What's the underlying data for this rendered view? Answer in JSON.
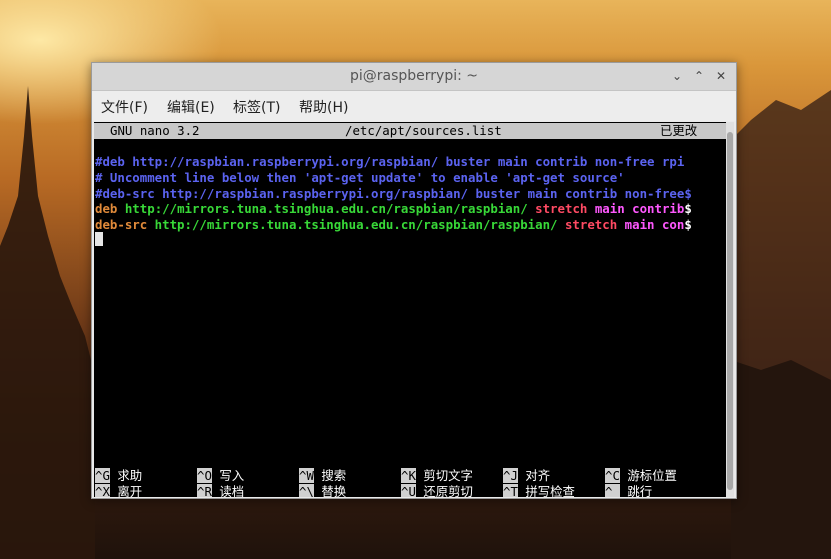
{
  "window": {
    "title": "pi@raspberrypi: ~",
    "controls": [
      "⌄",
      "⌃",
      "✕"
    ]
  },
  "menubar": {
    "items": [
      "文件(F)",
      "编辑(E)",
      "标签(T)",
      "帮助(H)"
    ]
  },
  "nano": {
    "version": "GNU nano 3.2",
    "filename": "/etc/apt/sources.list",
    "status": "已更改"
  },
  "lines": [
    {
      "segments": [
        {
          "text": "#deb http://raspbian.raspberrypi.org/raspbian/ buster main contrib non-free rpi",
          "color": "blue"
        }
      ]
    },
    {
      "segments": [
        {
          "text": "# Uncomment line below then 'apt-get update' to enable 'apt-get source'",
          "color": "blue"
        }
      ]
    },
    {
      "segments": [
        {
          "text": "#deb-src http://raspbian.raspberrypi.org/raspbian/ buster main contrib non-free$",
          "color": "blue"
        }
      ]
    },
    {
      "segments": [
        {
          "text": "deb",
          "color": "orange"
        },
        {
          "text": " http://mirrors.tuna.tsinghua.edu.cn/raspbian/raspbian/ ",
          "color": "green"
        },
        {
          "text": "stretch",
          "color": "red"
        },
        {
          "text": " main contrib",
          "color": "pink"
        },
        {
          "text": "$",
          "color": "white"
        }
      ]
    },
    {
      "segments": [
        {
          "text": "deb-src",
          "color": "orange"
        },
        {
          "text": " http://mirrors.tuna.tsinghua.edu.cn/raspbian/raspbian/ ",
          "color": "green"
        },
        {
          "text": "stretch",
          "color": "red"
        },
        {
          "text": " main con",
          "color": "pink"
        },
        {
          "text": "$",
          "color": "white"
        }
      ]
    }
  ],
  "shortcuts_row1": [
    {
      "key": "^G",
      "label": "求助"
    },
    {
      "key": "^O",
      "label": "写入"
    },
    {
      "key": "^W",
      "label": "搜索"
    },
    {
      "key": "^K",
      "label": "剪切文字"
    },
    {
      "key": "^J",
      "label": "对齐"
    },
    {
      "key": "^C",
      "label": "游标位置"
    }
  ],
  "shortcuts_row2": [
    {
      "key": "^X",
      "label": "离开"
    },
    {
      "key": "^R",
      "label": "读档"
    },
    {
      "key": "^\\",
      "label": "替换"
    },
    {
      "key": "^U",
      "label": "还原剪切"
    },
    {
      "key": "^T",
      "label": "拼写检查"
    },
    {
      "key": "^_",
      "label": "跳行"
    }
  ]
}
